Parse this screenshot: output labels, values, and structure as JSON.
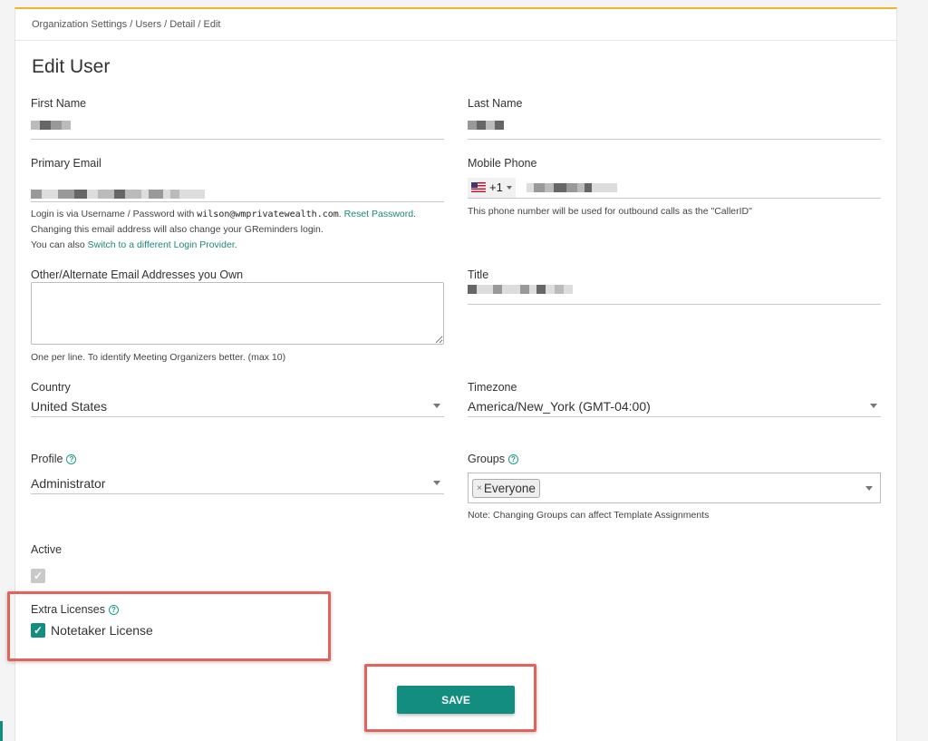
{
  "breadcrumb": "Organization Settings / Users / Detail / Edit",
  "page_title": "Edit User",
  "first_name": {
    "label": "First Name"
  },
  "last_name": {
    "label": "Last Name"
  },
  "primary_email": {
    "label": "Primary Email",
    "help_prefix": "Login is via Username / Password with ",
    "help_email": "wilson@wmprivatewealth.com",
    "help_after_email": ". ",
    "reset_link": "Reset Password",
    "help_suffix": ".",
    "help_line2": "Changing this email address will also change your GReminders login.",
    "help_line3_prefix": "You can also ",
    "switch_link": "Switch to a different Login Provider",
    "help_line3_suffix": "."
  },
  "mobile_phone": {
    "label": "Mobile Phone",
    "country_code": "+1",
    "help": "This phone number will be used for outbound calls as the \"CallerID\""
  },
  "alt_emails": {
    "label": "Other/Alternate Email Addresses you Own",
    "help": "One per line. To identify Meeting Organizers better. (max 10)"
  },
  "title": {
    "label": "Title"
  },
  "country": {
    "label": "Country",
    "value": "United States"
  },
  "timezone": {
    "label": "Timezone",
    "value": "America/New_York (GMT-04:00)"
  },
  "profile": {
    "label": "Profile",
    "value": "Administrator"
  },
  "groups": {
    "label": "Groups",
    "chip": "Everyone",
    "chip_remove": "×",
    "help": "Note: Changing Groups can affect Template Assignments"
  },
  "active": {
    "label": "Active",
    "checked": true
  },
  "extra_licenses": {
    "label": "Extra Licenses",
    "option": "Notetaker License",
    "checked": true
  },
  "save_label": "SAVE",
  "help_icon_glyph": "?",
  "check_glyph": "✓",
  "colors": {
    "accent": "#138d7f",
    "top_border": "#f0b429",
    "highlight_box": "#e0645c"
  }
}
